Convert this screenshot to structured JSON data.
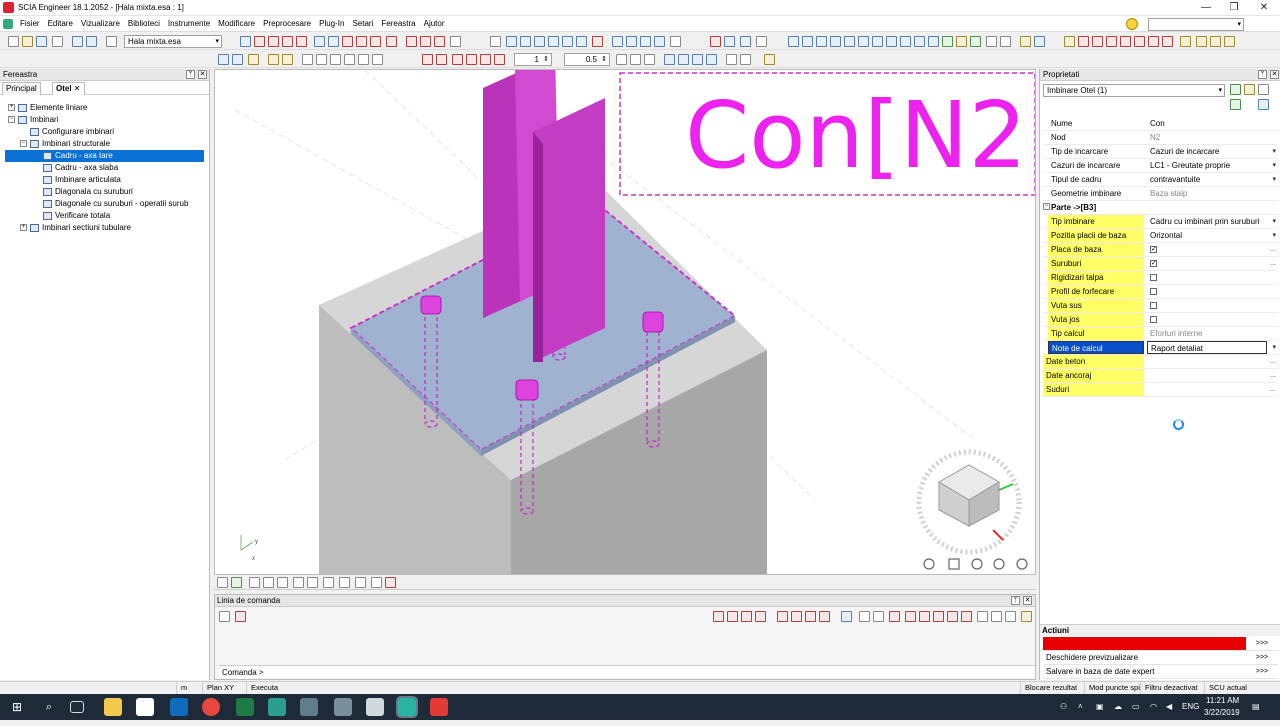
{
  "window": {
    "title": "SCIA Engineer 18.1.2052 - [Hala mixta.esa : 1]",
    "controls": [
      "—",
      "❐",
      "✕"
    ]
  },
  "menu": [
    "Fisier",
    "Editare",
    "Vizualizare",
    "Biblioteci",
    "Instrumente",
    "Modificare",
    "Preprocesare",
    "Plug-In",
    "Setari",
    "Fereastra",
    "Ajutor"
  ],
  "toolbar": {
    "project_combo": "Hala mixta.esa",
    "spin1": "1",
    "spin2": "0.5"
  },
  "left": {
    "header": "Fereastra",
    "tabs": [
      {
        "label": "Principal"
      },
      {
        "label": "Otel"
      }
    ],
    "tree": [
      {
        "label": "Elemente liniare",
        "level": 0,
        "expander": "+"
      },
      {
        "label": "Imbinari",
        "level": 0,
        "expander": "−"
      },
      {
        "label": "Configurare imbinari",
        "level": 1,
        "expander": ""
      },
      {
        "label": "Imbinari structurale",
        "level": 1,
        "expander": "−"
      },
      {
        "label": "Cadru - axa tare",
        "level": 2,
        "expander": "",
        "selected": true
      },
      {
        "label": "Cadru - axa slaba",
        "level": 2,
        "expander": ""
      },
      {
        "label": "Imbinare articulata",
        "level": 2,
        "expander": ""
      },
      {
        "label": "Diagonala cu suruburi",
        "level": 2,
        "expander": ""
      },
      {
        "label": "Diagonale cu suruburi - operatii surub",
        "level": 2,
        "expander": ""
      },
      {
        "label": "Verificare totala",
        "level": 2,
        "expander": ""
      },
      {
        "label": "Imbinari sectiuni tubulare",
        "level": 0,
        "expander": "+"
      }
    ]
  },
  "viewport": {
    "label_text": "Con[N2",
    "axis_y": "y",
    "axis_x": "x",
    "colors": {
      "steel": "#cc33cc",
      "plate": "#9fb2cf",
      "concrete": "#c8c8c8",
      "highlight": "#ff00ff"
    }
  },
  "command": {
    "header": "Linia de comanda",
    "prompt": "Comanda >"
  },
  "properties": {
    "header": "Proprietati",
    "selector": "Imbinare Otel (1)",
    "rows": [
      {
        "label": "Nume",
        "value": "Con",
        "style": "",
        "arrow": ""
      },
      {
        "label": "Nod",
        "value": "N2",
        "style": "grey",
        "arrow": ""
      },
      {
        "label": "Tip de incarcare",
        "value": "Cazuri de incarcare",
        "style": "",
        "arrow": "▾"
      },
      {
        "label": "Cazuri de incarcare",
        "value": "LC1 - Greutate proprie",
        "style": "",
        "arrow": "▾"
      },
      {
        "label": "Tipul de cadru",
        "value": "contravantuite",
        "style": "",
        "arrow": "▾"
      },
      {
        "label": "Geometrie imbinare",
        "value": "Baza stalp",
        "style": "grey",
        "arrow": ""
      }
    ],
    "section": "Parte ->[B3]",
    "part_rows": [
      {
        "label": "Tip imbinare",
        "value": "Cadru cu imbinari prin suruburi",
        "arrow": "▾",
        "checkbox": false
      },
      {
        "label": "Pozitia placii de baza",
        "value": "Orizontal",
        "arrow": "▾",
        "checkbox": false
      },
      {
        "label": "Placa de baza",
        "value": "✓",
        "arrow": "...",
        "checkbox": true
      },
      {
        "label": "Suruburi",
        "value": "✓",
        "arrow": "...",
        "checkbox": true
      },
      {
        "label": "Rigidizari talpa",
        "value": "",
        "arrow": "",
        "checkbox": true
      },
      {
        "label": "Profil de forfecare",
        "value": "",
        "arrow": "",
        "checkbox": true
      },
      {
        "label": "Vuta sus",
        "value": "",
        "arrow": "",
        "checkbox": true
      },
      {
        "label": "Vuta jos",
        "value": "",
        "arrow": "",
        "checkbox": true
      },
      {
        "label": "Tip calcul",
        "value": "Eforturi interne",
        "arrow": "",
        "checkbox": false,
        "grey": true
      },
      {
        "label": "Note de calcul",
        "value": "Raport detaliat",
        "arrow": "▾",
        "checkbox": false,
        "selected": true
      }
    ],
    "extra_rows": [
      {
        "label": "Date beton",
        "arrow": "..."
      },
      {
        "label": "Date ancoraj",
        "arrow": "..."
      },
      {
        "label": "Suduri",
        "arrow": "..."
      }
    ],
    "actions_header": "Actiuni",
    "actions": [
      {
        "label": "Actualizare",
        "button": ">>>",
        "highlight": true
      },
      {
        "label": "Deschidere previzualizare",
        "button": ">>>",
        "highlight": false
      },
      {
        "label": "Salvare in baza de date expert",
        "button": ">>>",
        "highlight": false
      }
    ]
  },
  "status": {
    "unit": "m",
    "plane": "Plan XY",
    "mode": "Executa",
    "right": [
      "Blocare rezultat",
      "Mod puncte spi",
      "Filtru dezactivat",
      "SCU actual"
    ]
  },
  "taskbar": {
    "lang": "ENG",
    "time": "11:21 AM",
    "date": "3/22/2019"
  }
}
